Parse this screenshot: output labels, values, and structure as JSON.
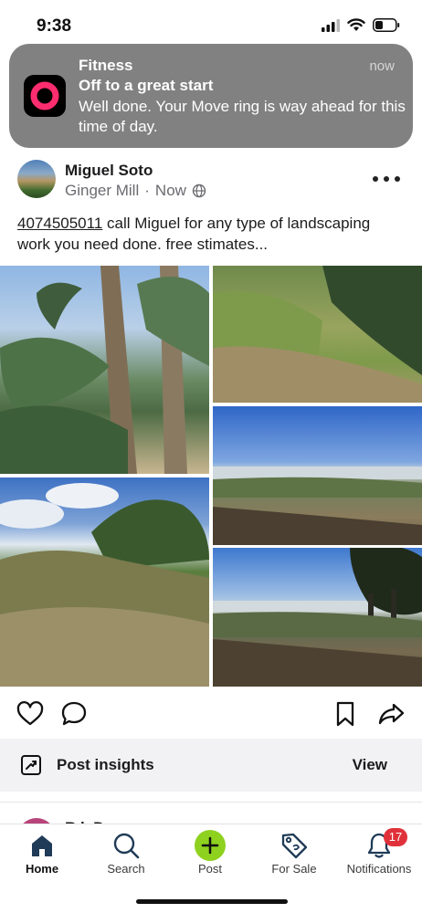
{
  "status_bar": {
    "time": "9:38"
  },
  "notification": {
    "app": "Fitness",
    "time": "now",
    "title": "Off to a great start",
    "body": "Well done. Your Move ring is way ahead for this time of day."
  },
  "post": {
    "author": "Miguel Soto",
    "location": "Ginger Mill",
    "separator": "·",
    "posted": "Now",
    "phone": "4074505011",
    "text": " call Miguel for any type of landscaping work you need done. free stimates..."
  },
  "insights": {
    "label": "Post insights",
    "view": "View"
  },
  "next_post": {
    "author": "R   k  D"
  },
  "tabs": [
    {
      "label": "Home",
      "icon": "home-icon"
    },
    {
      "label": "Search",
      "icon": "search-icon"
    },
    {
      "label": "Post",
      "icon": "plus-icon"
    },
    {
      "label": "For Sale",
      "icon": "tag-icon"
    },
    {
      "label": "Notifications",
      "icon": "bell-icon",
      "badge": "17"
    }
  ],
  "colors": {
    "accent": "#8ed11f",
    "badge": "#e0313b",
    "ring": "#ff2d6f"
  }
}
